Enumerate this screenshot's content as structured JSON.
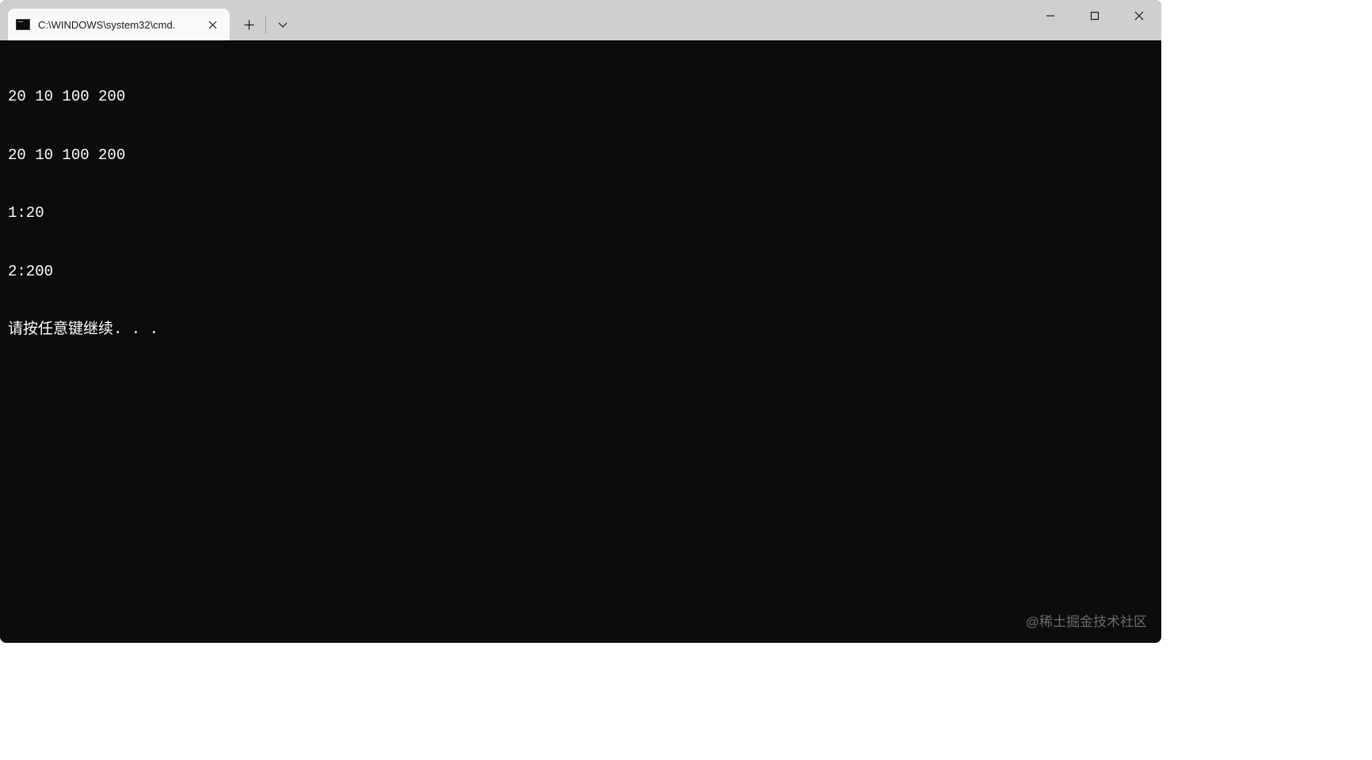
{
  "window": {
    "tab_title": "C:\\WINDOWS\\system32\\cmd.",
    "icon_name": "cmd-icon"
  },
  "terminal": {
    "lines": [
      "20 10 100 200",
      "20 10 100 200",
      "1:20",
      "2:200",
      "请按任意键继续. . ."
    ]
  },
  "watermark": "@稀土掘金技术社区"
}
